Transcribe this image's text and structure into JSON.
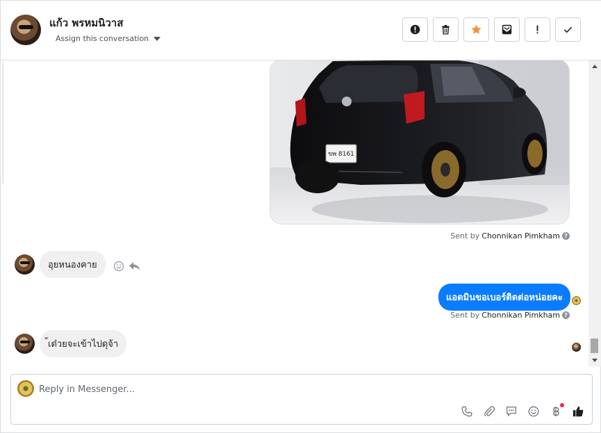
{
  "contact": {
    "name": "แก้ว พรหมนิวาส",
    "assign_label": "Assign this conversation"
  },
  "actions": [
    {
      "icon": "alert-circle-icon",
      "color": "#1c1e21"
    },
    {
      "icon": "trash-icon",
      "color": "#1c1e21"
    },
    {
      "icon": "star-icon",
      "color": "#f7923b"
    },
    {
      "icon": "envelope-icon",
      "color": "#1c1e21"
    },
    {
      "icon": "exclamation-icon",
      "color": "#1c1e21"
    },
    {
      "icon": "check-icon",
      "color": "#1c1e21"
    }
  ],
  "messages": {
    "photo_sent_by_prefix": "Sent by",
    "photo_sent_by_name": "Chonnikan Pimkham",
    "incoming_1": "อุยหนองคาย",
    "outgoing_1": "แอดมินขอเบอร์ติดต่อหน่อยคะ",
    "sent_by_prefix": "Sent by",
    "sent_by_name": "Chonnikan Pimkham",
    "incoming_2": "้เด๋วยจะเข้าไปดุจ้า",
    "photo_plate": "ขพ 8161"
  },
  "composer": {
    "placeholder": "Reply in Messenger...",
    "tools": [
      "phone-icon",
      "paperclip-icon",
      "chat-bubble-icon",
      "emoji-icon",
      "baht-icon",
      "thumbs-up-icon"
    ]
  },
  "colors": {
    "accent": "#0a7cff",
    "star": "#f7923b",
    "notification": "#f02849"
  }
}
